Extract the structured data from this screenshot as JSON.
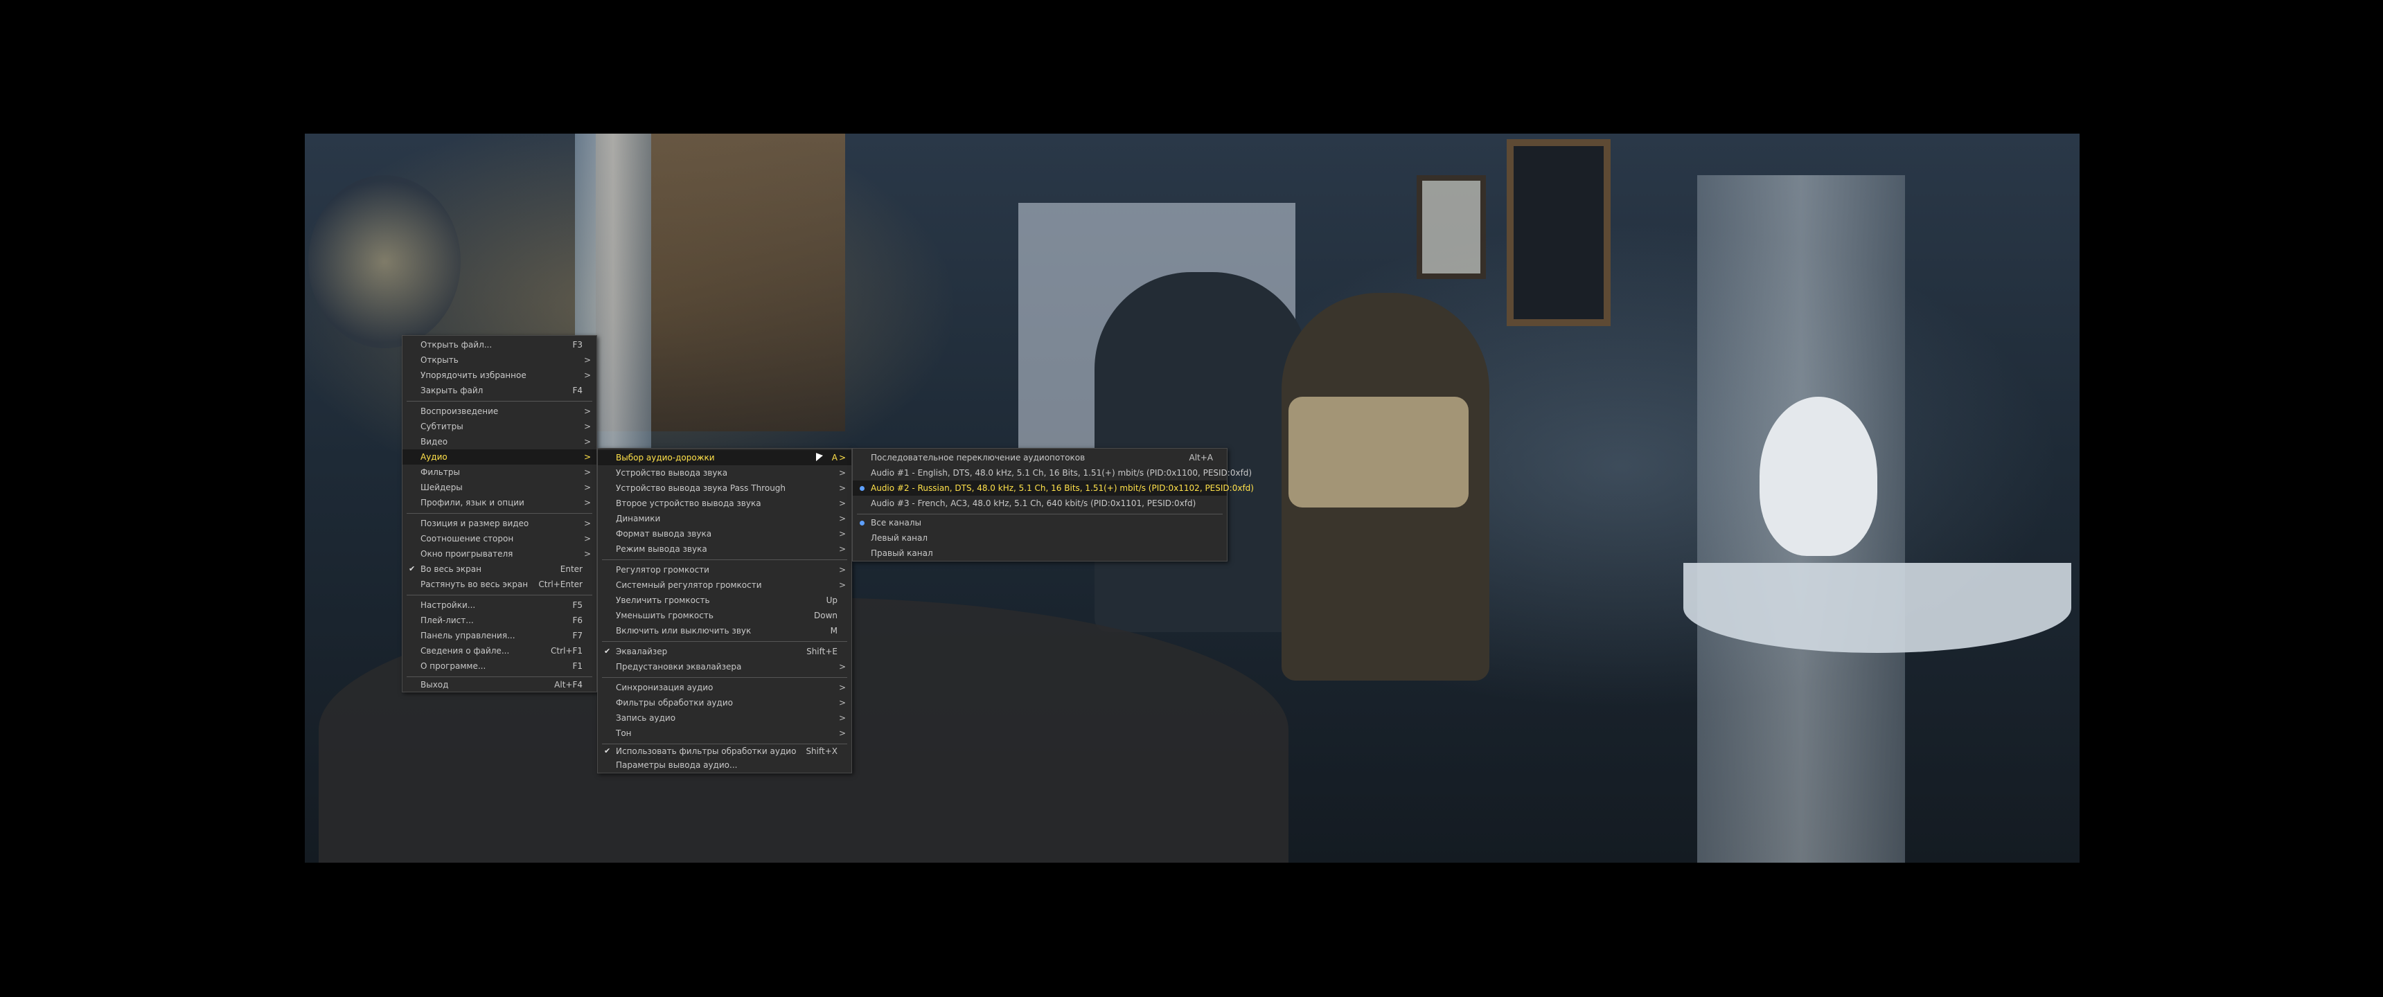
{
  "menu1": {
    "items": [
      {
        "label": "Открыть файл...",
        "shortcut": "F3",
        "arrow": ""
      },
      {
        "label": "Открыть",
        "shortcut": "",
        "arrow": ">"
      },
      {
        "label": "Упорядочить избранное",
        "shortcut": "",
        "arrow": ">"
      },
      {
        "label": "Закрыть файл",
        "shortcut": "F4",
        "arrow": ""
      },
      {
        "label": "Воспроизведение",
        "shortcut": "",
        "arrow": ">"
      },
      {
        "label": "Субтитры",
        "shortcut": "",
        "arrow": ">"
      },
      {
        "label": "Видео",
        "shortcut": "",
        "arrow": ">"
      },
      {
        "label": "Аудио",
        "shortcut": "",
        "arrow": ">"
      },
      {
        "label": "Фильтры",
        "shortcut": "",
        "arrow": ">"
      },
      {
        "label": "Шейдеры",
        "shortcut": "",
        "arrow": ">"
      },
      {
        "label": "Профили, язык и опции",
        "shortcut": "",
        "arrow": ">"
      },
      {
        "label": "Позиция и размер видео",
        "shortcut": "",
        "arrow": ">"
      },
      {
        "label": "Соотношение сторон",
        "shortcut": "",
        "arrow": ">"
      },
      {
        "label": "Окно проигрывателя",
        "shortcut": "",
        "arrow": ">"
      },
      {
        "label": "Во весь экран",
        "shortcut": "Enter",
        "arrow": ""
      },
      {
        "label": "Растянуть во весь экран",
        "shortcut": "Ctrl+Enter",
        "arrow": ""
      },
      {
        "label": "Настройки...",
        "shortcut": "F5",
        "arrow": ""
      },
      {
        "label": "Плей-лист...",
        "shortcut": "F6",
        "arrow": ""
      },
      {
        "label": "Панель управления...",
        "shortcut": "F7",
        "arrow": ""
      },
      {
        "label": "Сведения о файле...",
        "shortcut": "Ctrl+F1",
        "arrow": ""
      },
      {
        "label": "О программе...",
        "shortcut": "F1",
        "arrow": ""
      },
      {
        "label": "Выход",
        "shortcut": "Alt+F4",
        "arrow": ""
      }
    ]
  },
  "menu2": {
    "items": [
      {
        "label": "Выбор аудио-дорожки",
        "shortcut": "A",
        "arrow": ">"
      },
      {
        "label": "Устройство вывода звука",
        "shortcut": "",
        "arrow": ">"
      },
      {
        "label": "Устройство вывода звука Pass Through",
        "shortcut": "",
        "arrow": ">"
      },
      {
        "label": "Второе устройство вывода звука",
        "shortcut": "",
        "arrow": ">"
      },
      {
        "label": "Динамики",
        "shortcut": "",
        "arrow": ">"
      },
      {
        "label": "Формат вывода звука",
        "shortcut": "",
        "arrow": ">"
      },
      {
        "label": "Режим вывода звука",
        "shortcut": "",
        "arrow": ">"
      },
      {
        "label": "Регулятор громкости",
        "shortcut": "",
        "arrow": ">"
      },
      {
        "label": "Системный регулятор громкости",
        "shortcut": "",
        "arrow": ">"
      },
      {
        "label": "Увеличить громкость",
        "shortcut": "Up",
        "arrow": ""
      },
      {
        "label": "Уменьшить громкость",
        "shortcut": "Down",
        "arrow": ""
      },
      {
        "label": "Включить или выключить звук",
        "shortcut": "M",
        "arrow": ""
      },
      {
        "label": "Эквалайзер",
        "shortcut": "Shift+E",
        "arrow": ""
      },
      {
        "label": "Предустановки эквалайзера",
        "shortcut": "",
        "arrow": ">"
      },
      {
        "label": "Синхронизация аудио",
        "shortcut": "",
        "arrow": ">"
      },
      {
        "label": "Фильтры обработки аудио",
        "shortcut": "",
        "arrow": ">"
      },
      {
        "label": "Запись аудио",
        "shortcut": "",
        "arrow": ">"
      },
      {
        "label": "Тон",
        "shortcut": "",
        "arrow": ">"
      },
      {
        "label": "Использовать фильтры обработки аудио",
        "shortcut": "Shift+X",
        "arrow": ""
      },
      {
        "label": "Параметры вывода аудио...",
        "shortcut": "",
        "arrow": ""
      }
    ]
  },
  "menu3": {
    "items": [
      {
        "label": "Последовательное переключение аудиопотоков",
        "shortcut": "Alt+A"
      },
      {
        "label": "Audio #1 - English, DTS, 48.0 kHz, 5.1 Ch, 16 Bits, 1.51(+) mbit/s (PID:0x1100, PESID:0xfd)",
        "shortcut": ""
      },
      {
        "label": "Audio #2 - Russian, DTS, 48.0 kHz, 5.1 Ch, 16 Bits, 1.51(+) mbit/s (PID:0x1102, PESID:0xfd)",
        "shortcut": ""
      },
      {
        "label": "Audio #3 - French, AC3, 48.0 kHz, 5.1 Ch, 640 kbit/s (PID:0x1101, PESID:0xfd)",
        "shortcut": ""
      },
      {
        "label": "Все каналы",
        "shortcut": ""
      },
      {
        "label": "Левый канал",
        "shortcut": ""
      },
      {
        "label": "Правый канал",
        "shortcut": ""
      }
    ]
  }
}
